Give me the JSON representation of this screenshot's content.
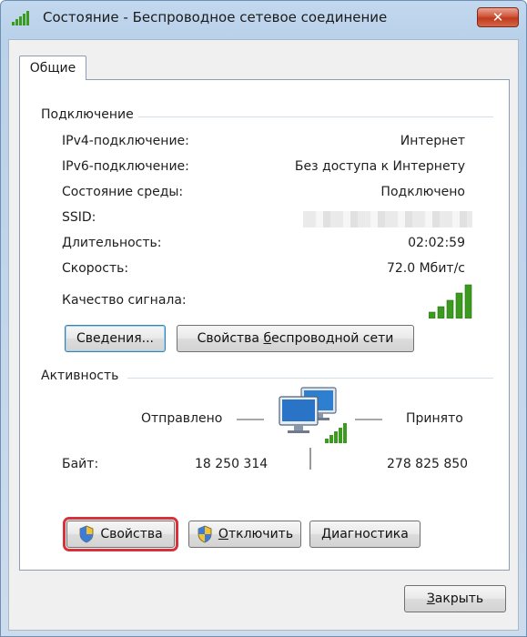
{
  "window": {
    "title": "Состояние - Беспроводное сетевое соединение",
    "close_glyph": "✕"
  },
  "tabs": [
    {
      "label": "Общие",
      "active": true
    }
  ],
  "connection": {
    "group_title": "Подключение",
    "rows": [
      {
        "label": "IPv4-подключение:",
        "value": "Интернет"
      },
      {
        "label": "IPv6-подключение:",
        "value": "Без доступа к Интернету"
      },
      {
        "label": "Состояние среды:",
        "value": "Подключено"
      },
      {
        "label": "SSID:",
        "value": ""
      },
      {
        "label": "Длительность:",
        "value": "02:02:59"
      },
      {
        "label": "Скорость:",
        "value": "72.0 Мбит/с"
      }
    ],
    "signal_label": "Качество сигнала:",
    "signal_bars_active": 5,
    "signal_bars_total": 5,
    "details_button": "Сведения...",
    "wireless_props_button_prefix": "Свойства ",
    "wireless_props_button_ul": "б",
    "wireless_props_button_suffix": "еспроводной сети"
  },
  "activity": {
    "group_title": "Активность",
    "sent_label": "Отправлено",
    "received_label": "Принято",
    "bytes_label": "Байт:",
    "bytes_sent": "18 250 314",
    "bytes_received": "278 825 850"
  },
  "buttons": {
    "properties": "Свойства",
    "disconnect_ul": "О",
    "disconnect_rest": "тключить",
    "diagnostics_ul": "Д",
    "diagnostics_rest": "иагностика",
    "close_ul": "З",
    "close_rest": "акрыть"
  },
  "colors": {
    "signal_green": "#3a9b1e",
    "highlight_red": "#d8313a"
  }
}
